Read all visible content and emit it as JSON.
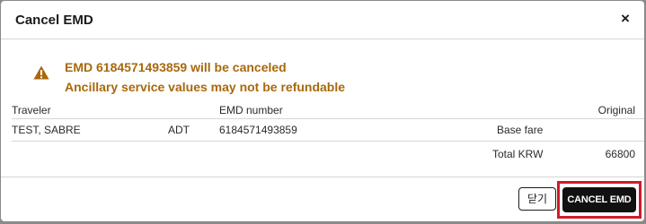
{
  "dialog": {
    "title": "Cancel EMD",
    "close_glyph": "×"
  },
  "warning": {
    "icon": "warning-triangle-icon",
    "line1": "EMD 6184571493859 will be canceled",
    "line2": "Ancillary service values may not be refundable",
    "color": "#a8680b"
  },
  "table": {
    "headers": {
      "traveler": "Traveler",
      "emd_number": "EMD number",
      "original": "Original"
    },
    "row": {
      "traveler": "TEST, SABRE",
      "type": "ADT",
      "emd_number": "6184571493859",
      "fare_label": "Base fare",
      "fare_value": ""
    },
    "total": {
      "label": "Total KRW",
      "value": "66800"
    }
  },
  "buttons": {
    "close_label": "닫기",
    "cancel_emd_label": "CANCEL EMD"
  },
  "colors": {
    "highlight": "#d11a2a",
    "primary_button": "#111111"
  }
}
